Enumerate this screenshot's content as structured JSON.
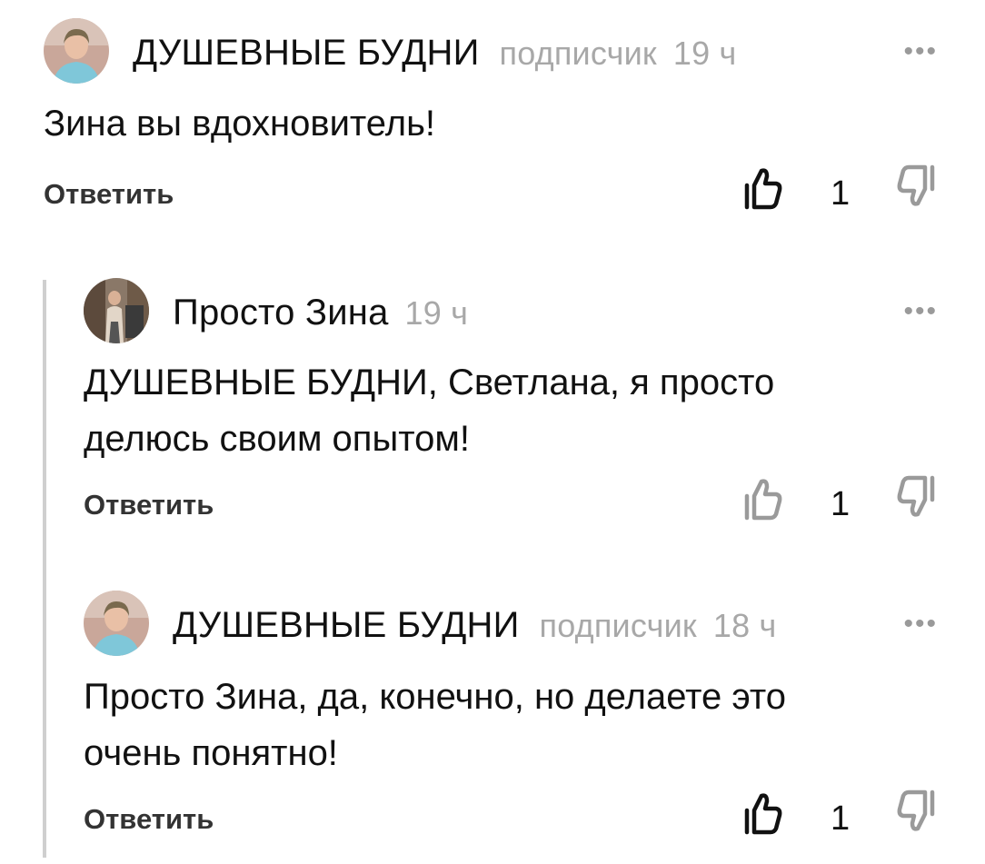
{
  "comments": [
    {
      "author": "ДУШЕВНЫЕ БУДНИ",
      "badge": "подписчик",
      "time": "19 ч",
      "more": "•••",
      "text_lines": [
        "Зина вы вдохновитель!"
      ],
      "reply_label": "Ответить",
      "likes": "1",
      "liked": true
    },
    {
      "author": "Просто Зина",
      "badge": "",
      "time": "19 ч",
      "more": "•••",
      "text_lines": [
        "ДУШЕВНЫЕ БУДНИ, Светлана, я просто",
        "делюсь своим опытом!"
      ],
      "reply_label": "Ответить",
      "likes": "1",
      "liked": false
    },
    {
      "author": "ДУШЕВНЫЕ БУДНИ",
      "badge": "подписчик",
      "time": "18 ч",
      "more": "•••",
      "text_lines": [
        "Просто Зина, да, конечно, но делаете это",
        "очень понятно!"
      ],
      "reply_label": "Ответить",
      "likes": "1",
      "liked": true
    }
  ],
  "colors": {
    "text": "#111111",
    "muted": "#a8a8a8",
    "thread_line": "#cfcfcf",
    "icon_active": "#111111",
    "icon_inactive": "#9a9a9a"
  },
  "icons": {
    "like": "thumbs-up-icon",
    "dislike": "thumbs-down-icon",
    "more": "more-dots-icon"
  }
}
